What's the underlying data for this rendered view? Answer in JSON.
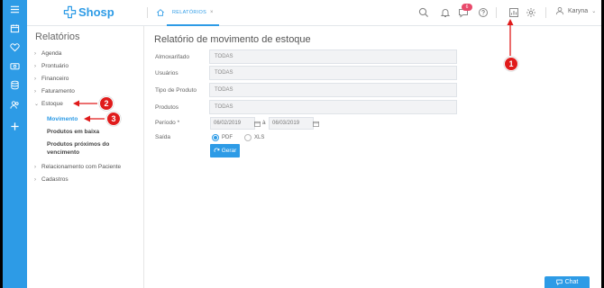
{
  "app": {
    "brand": "Shosp",
    "tab_label": "RELATÓRIOS",
    "tab_close": "×",
    "notification_count": "6",
    "user_name": "Karyna"
  },
  "nav": {
    "title": "Relatórios",
    "items": [
      {
        "label": "Agenda",
        "chevron": "›"
      },
      {
        "label": "Prontuário",
        "chevron": "›"
      },
      {
        "label": "Financeiro",
        "chevron": "›"
      },
      {
        "label": "Faturamento",
        "chevron": "›"
      },
      {
        "label": "Estoque",
        "chevron": "⌄"
      },
      {
        "label": "Relacionamento com Paciente",
        "chevron": "›"
      },
      {
        "label": "Cadastros",
        "chevron": "›"
      }
    ],
    "estoque_sub": [
      {
        "label": "Movimento"
      },
      {
        "label": "Produtos em baixa"
      },
      {
        "label": "Produtos próximos do vencimento"
      }
    ]
  },
  "main": {
    "title": "Relatório de movimento de estoque",
    "fields": [
      {
        "label": "Almoxarifado",
        "value": "TODAS"
      },
      {
        "label": "Usuários",
        "value": "TODAS"
      },
      {
        "label": "Tipo de Produto",
        "value": "TODAS"
      },
      {
        "label": "Produtos",
        "value": "TODAS"
      }
    ],
    "period": {
      "label": "Período *",
      "start": "06/02/2019",
      "separator": "à",
      "end": "06/03/2019"
    },
    "output": {
      "label": "Saída",
      "options": [
        "PDF",
        "XLS"
      ],
      "selected": "PDF"
    },
    "generate_label": "Gerar"
  },
  "chat": {
    "label": "Chat"
  },
  "markers": [
    "1",
    "2",
    "3"
  ],
  "colors": {
    "accent": "#2d9be6",
    "marker": "#e01b1b",
    "badge": "#e84a6b"
  }
}
